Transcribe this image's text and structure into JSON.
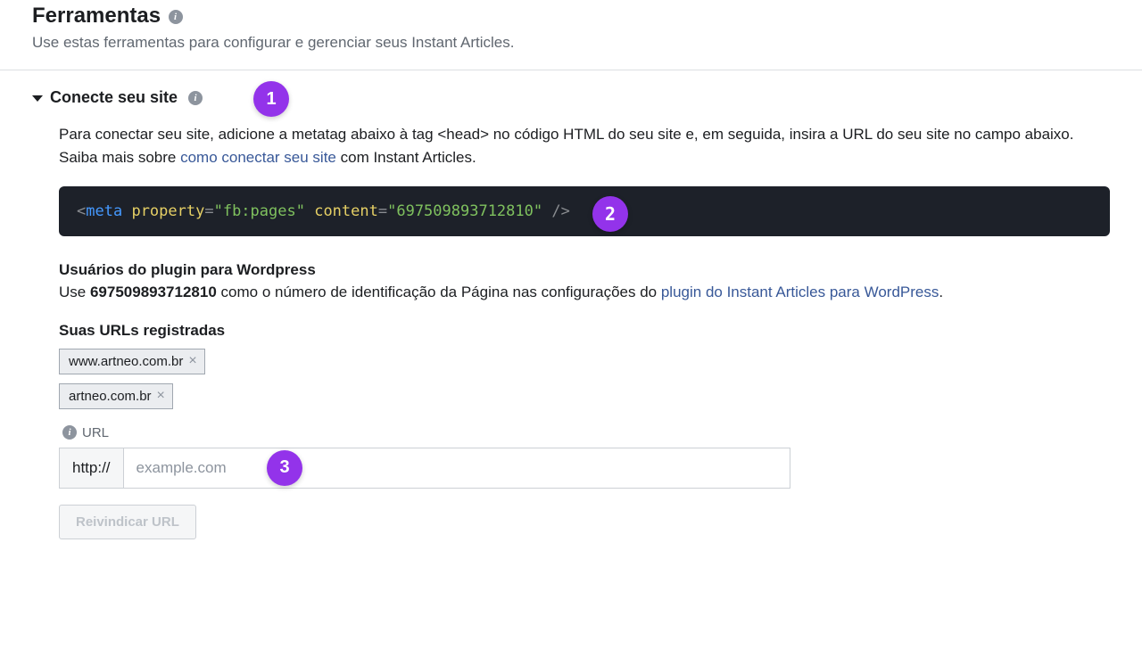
{
  "header": {
    "title": "Ferramentas",
    "subtitle": "Use estas ferramentas para configurar e gerenciar seus Instant Articles."
  },
  "section": {
    "title": "Conecte seu site",
    "desc_pre": "Para conectar seu site, adicione a metatag abaixo à tag <head> no código HTML do seu site e, em seguida, insira a URL do seu site no campo abaixo. Saiba mais sobre ",
    "desc_link": "como conectar seu site",
    "desc_post": " com Instant Articles."
  },
  "meta_tag": {
    "open": "<",
    "tag": "meta",
    "attr1_name": "property",
    "attr1_value": "\"fb:pages\"",
    "attr2_name": "content",
    "attr2_value": "\"697509893712810\"",
    "close": "/>"
  },
  "wordpress": {
    "heading": "Usuários do plugin para Wordpress",
    "pre": "Use ",
    "page_id": "697509893712810",
    "mid": " como o número de identificação da Página nas configurações do ",
    "link": "plugin do Instant Articles para WordPress",
    "post": "."
  },
  "registered_urls": {
    "heading": "Suas URLs registradas",
    "items": [
      "www.artneo.com.br",
      "artneo.com.br"
    ]
  },
  "url_input": {
    "label": "URL",
    "prefix": "http://",
    "placeholder": "example.com"
  },
  "claim_button": "Reivindicar URL",
  "callouts": {
    "b1": "1",
    "b2": "2",
    "b3": "3"
  },
  "chip_remove": "×",
  "info_glyph": "i"
}
